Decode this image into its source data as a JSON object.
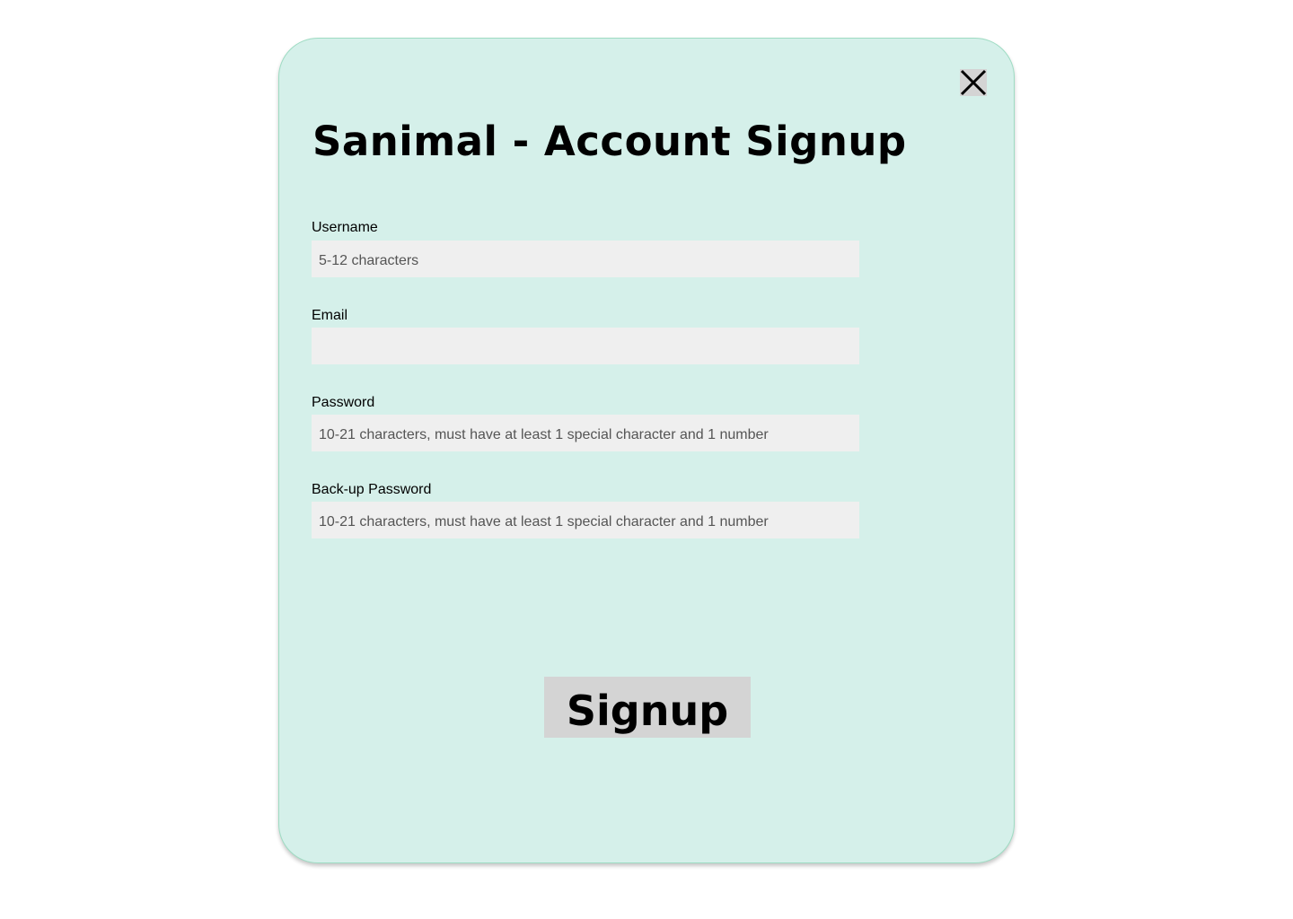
{
  "dialog": {
    "title": "Sanimal - Account Signup",
    "close_icon": "close-icon"
  },
  "fields": {
    "username": {
      "label": "Username",
      "placeholder": "5-12 characters",
      "value": ""
    },
    "email": {
      "label": "Email",
      "placeholder": "",
      "value": ""
    },
    "password": {
      "label": "Password",
      "placeholder": "10-21 characters, must have at least 1 special character and 1 number",
      "value": ""
    },
    "backup_password": {
      "label": "Back-up Password",
      "placeholder": "10-21 characters, must have at least 1 special character and 1 number",
      "value": ""
    }
  },
  "actions": {
    "signup_label": "Signup"
  },
  "colors": {
    "dialog_background": "#d5f0ea",
    "dialog_border": "#9edcc3",
    "input_background": "#efefef",
    "button_background": "#d4d4d4"
  }
}
